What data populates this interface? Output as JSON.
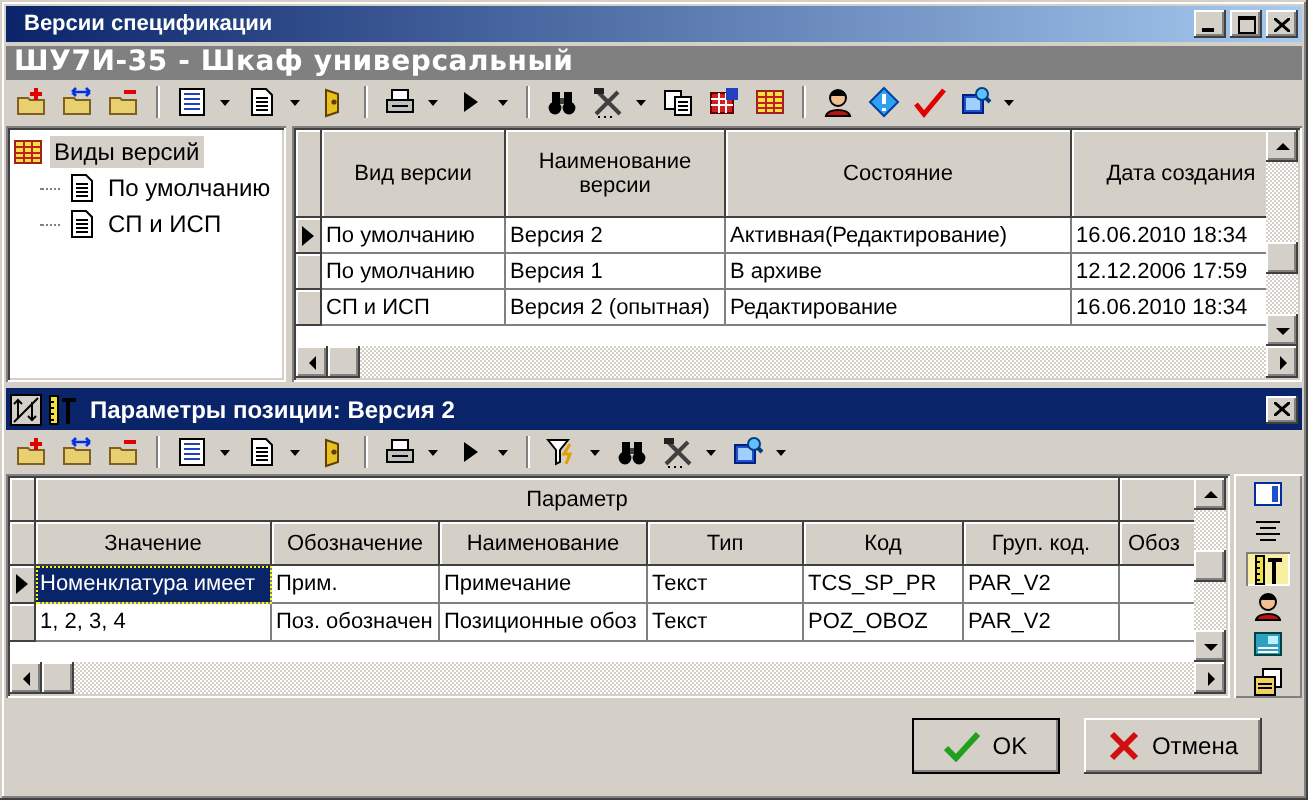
{
  "window": {
    "title": "Версии спецификации"
  },
  "header": {
    "title": "ШУ7И-35 - Шкаф универсальный"
  },
  "tree": {
    "label": "Виды версий",
    "selected": true,
    "children": [
      {
        "label": "По умолчанию",
        "selected": false
      },
      {
        "label": "СП и ИСП",
        "selected": false
      }
    ]
  },
  "versions": {
    "columns": [
      "Вид версии",
      "Наименование версии",
      "Состояние",
      "Дата создания"
    ],
    "rows": [
      {
        "cells": [
          "По умолчанию",
          "Версия 2",
          "Активная(Редактирование)",
          "16.06.2010 18:34"
        ],
        "selected": true
      },
      {
        "cells": [
          "По умолчанию",
          "Версия 1",
          "В архиве",
          "12.12.2006 17:59"
        ],
        "selected": false
      },
      {
        "cells": [
          "СП и ИСП",
          "Версия 2 (опытная)",
          "Редактирование",
          "16.06.2010 18:34"
        ],
        "selected": false
      }
    ]
  },
  "panel": {
    "title": "Параметры позиции: Версия 2"
  },
  "parameters": {
    "group_header": "Параметр",
    "columns": [
      "Значение",
      "Обозначение",
      "Наименование",
      "Тип",
      "Код",
      "Груп. код.",
      "Обоз"
    ],
    "rows": [
      {
        "cells": [
          "Номенклатура имеет",
          "Прим.",
          "Примечание",
          "Текст",
          "TCS_SP_PR",
          "PAR_V2"
        ],
        "selected": true
      },
      {
        "cells": [
          "1, 2, 3, 4",
          "Поз. обозначен",
          "Позиционные обоз",
          "Текст",
          "POZ_OBOZ",
          "PAR_V2"
        ],
        "selected": false
      }
    ]
  },
  "buttons": [
    {
      "label": "OK",
      "kind": "ok"
    },
    {
      "label": "Отмена",
      "kind": "cancel"
    }
  ]
}
